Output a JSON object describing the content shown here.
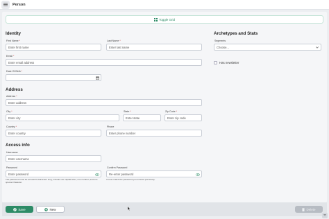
{
  "header": {
    "title": "Person"
  },
  "toolbar": {
    "toggle_grid_label": "Toggle Grid"
  },
  "identity": {
    "heading": "Identity",
    "first_name": {
      "label": "First Name",
      "placeholder": "Enter first name"
    },
    "last_name": {
      "label": "Last Name",
      "placeholder": "Enter last name"
    },
    "email": {
      "label": "Email",
      "placeholder": "Enter email address"
    },
    "date_of_birth": {
      "label": "Date Of Birth",
      "value": ""
    }
  },
  "archetypes": {
    "heading": "Archetypes and Stats",
    "segments": {
      "label": "Segments",
      "value": "Choose..."
    },
    "has_newsletter": {
      "label": "Has newsletter",
      "checked": false
    }
  },
  "address": {
    "heading": "Address",
    "address": {
      "label": "Address",
      "placeholder": "Enter address"
    },
    "city": {
      "label": "City",
      "placeholder": "Enter city"
    },
    "state": {
      "label": "State",
      "placeholder": "Enter state"
    },
    "zip": {
      "label": "Zip Code",
      "placeholder": "Enter zip code"
    },
    "country": {
      "label": "Country",
      "placeholder": "Enter country"
    },
    "phone": {
      "label": "Phone",
      "placeholder": "Enter phone number"
    }
  },
  "access": {
    "heading": "Access info",
    "username": {
      "label": "Username",
      "placeholder": "Enter username"
    },
    "password": {
      "label": "Password",
      "placeholder": "Enter password",
      "help": "The password must be at least 8 characters long, include one capital letter, one number, and one special character."
    },
    "confirm_password": {
      "label": "Confirm Password",
      "placeholder": "Re-enter password",
      "help": "It must match the password you entered previously."
    }
  },
  "actions": {
    "save_label": "Save",
    "new_label": "New",
    "delete_label": "Delete"
  },
  "colors": {
    "accent": "#2c8b66",
    "required": "#d14343",
    "background": "#eceef1"
  },
  "icons": [
    "menu-icon",
    "grid-icon",
    "calendar-icon",
    "chevron-down-icon",
    "eye-icon",
    "check-circle-icon",
    "plus-circle-icon",
    "trash-icon",
    "scroll-top-icon",
    "cursor-icon"
  ]
}
